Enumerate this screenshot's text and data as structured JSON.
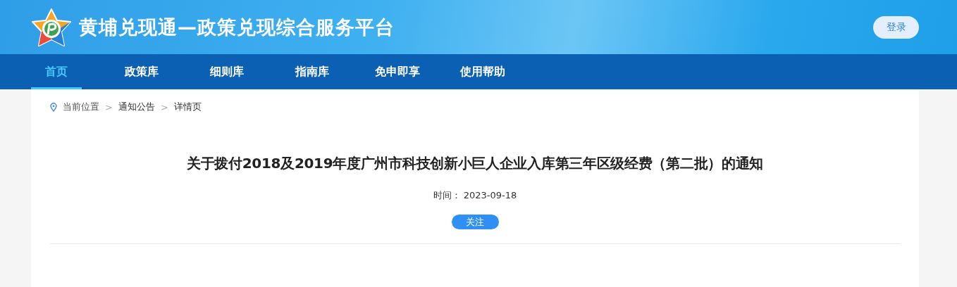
{
  "header": {
    "site_title": "黄埔兑现通—政策兑现综合服务平台",
    "login_button": "登录"
  },
  "nav": [
    {
      "label": "首页",
      "selected": true
    },
    {
      "label": "政策库",
      "selected": false
    },
    {
      "label": "细则库",
      "selected": false
    },
    {
      "label": "指南库",
      "selected": false
    },
    {
      "label": "免申即享",
      "selected": false
    },
    {
      "label": "使用帮助",
      "selected": false
    }
  ],
  "breadcrumb": {
    "items": [
      "当前位置",
      "通知公告",
      "详情页"
    ],
    "separator": ">"
  },
  "article": {
    "title": "关于拨付2018及2019年度广州市科技创新小巨人企业入库第三年区级经费（第二批）的通知",
    "time": "时间： 2023-09-18",
    "follow_button": "关注"
  }
}
